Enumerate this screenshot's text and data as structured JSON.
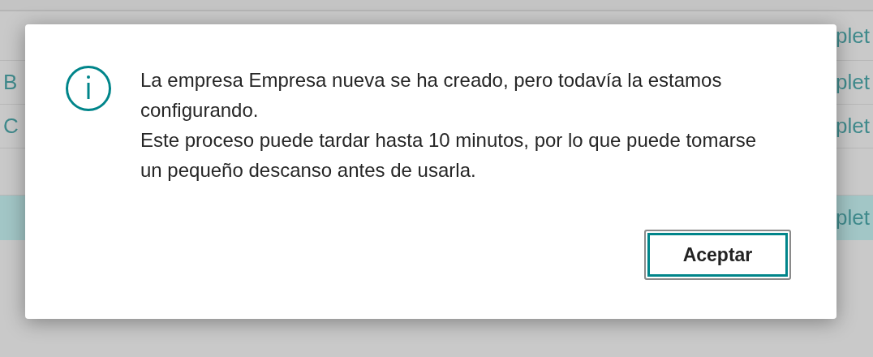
{
  "background_table": {
    "rows": [
      {
        "right": "plet",
        "selected": false
      },
      {
        "left": "B",
        "right": "plet",
        "selected": false
      },
      {
        "left": "C",
        "right": "plet",
        "selected": false
      },
      {
        "selected": false
      },
      {
        "right": "plet",
        "selected": true
      }
    ]
  },
  "dialog": {
    "message": [
      "La empresa Empresa nueva se ha creado, pero todavía la estamos configurando.",
      "Este proceso puede tardar hasta 10 minutos, por lo que puede tomarse un pequeño descanso antes de usarla."
    ],
    "button": "Aceptar"
  }
}
